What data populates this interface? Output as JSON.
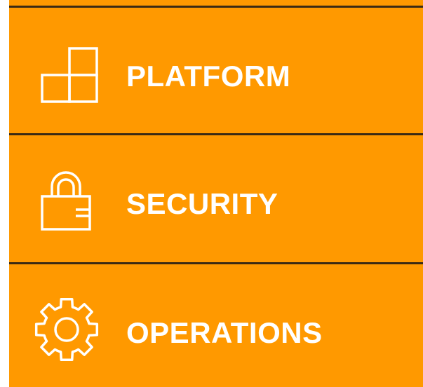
{
  "menu": {
    "background_color": "#ff9900",
    "text_color": "#ffffff",
    "items": [
      {
        "label": "PLATFORM",
        "icon": "blocks-icon"
      },
      {
        "label": "SECURITY",
        "icon": "lock-icon"
      },
      {
        "label": "OPERATIONS",
        "icon": "gear-icon"
      }
    ]
  }
}
